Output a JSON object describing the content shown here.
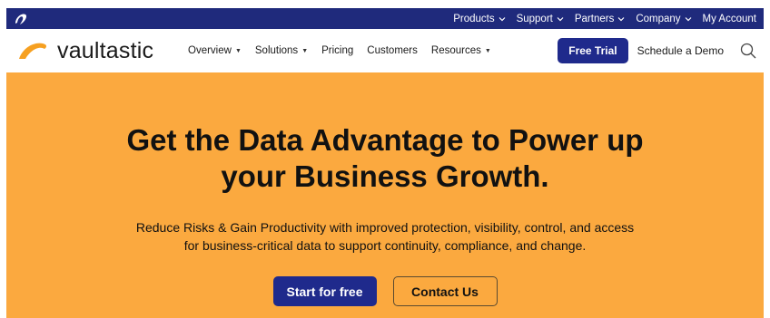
{
  "topbar": {
    "brand_icon": "swoosh-icon",
    "items": [
      {
        "label": "Products",
        "has_caret": true
      },
      {
        "label": "Support",
        "has_caret": true
      },
      {
        "label": "Partners",
        "has_caret": true
      },
      {
        "label": "Company",
        "has_caret": true
      },
      {
        "label": "My Account",
        "has_caret": false
      }
    ],
    "bg_color": "#1f2a7c"
  },
  "nav": {
    "logo_text": "vaultastic",
    "menu": [
      {
        "label": "Overview",
        "has_caret": true
      },
      {
        "label": "Solutions",
        "has_caret": true
      },
      {
        "label": "Pricing",
        "has_caret": false
      },
      {
        "label": "Customers",
        "has_caret": false
      },
      {
        "label": "Resources",
        "has_caret": true
      }
    ],
    "trial_label": "Free Trial",
    "demo_label": "Schedule a Demo",
    "search_icon": "search-icon"
  },
  "hero": {
    "title_line1": "Get the Data Advantage to Power up",
    "title_line2": "your Business Growth.",
    "sub_line1": "Reduce Risks & Gain Productivity with improved protection, visibility, control, and access",
    "sub_line2": "for business-critical data to support continuity, compliance, and change.",
    "primary_cta": "Start for free",
    "secondary_cta": "Contact Us",
    "bg_color": "#fba93f",
    "accent_color": "#1f2a8c"
  }
}
